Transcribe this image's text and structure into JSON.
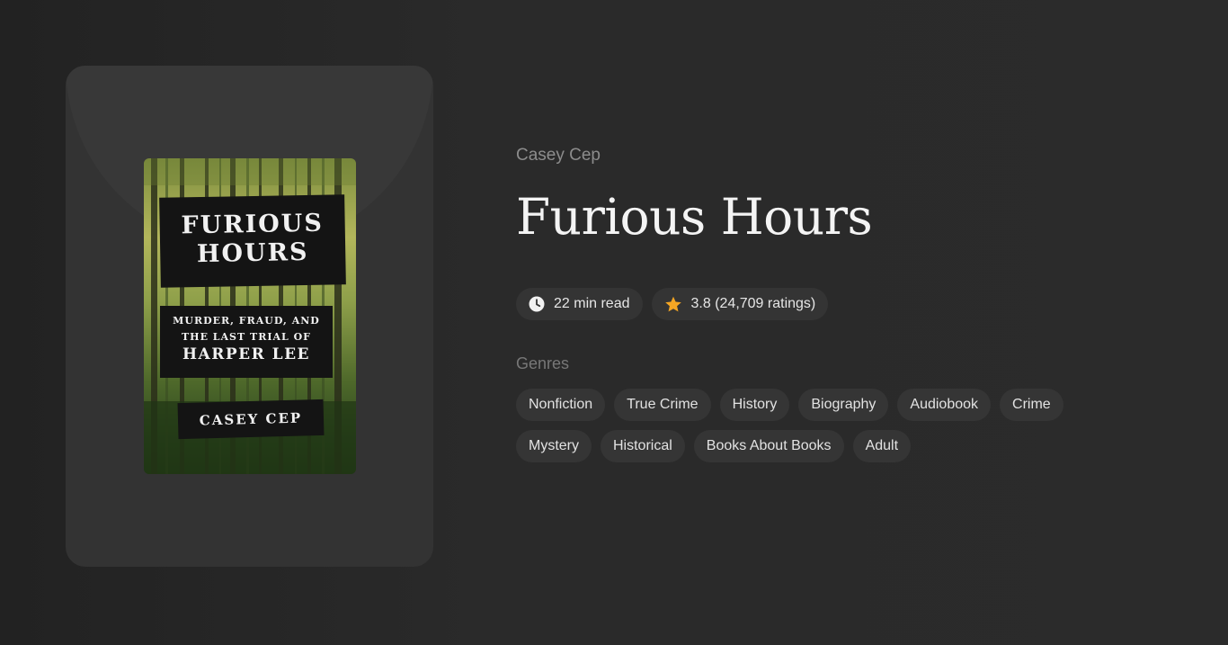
{
  "book": {
    "author": "Casey Cep",
    "title": "Furious Hours",
    "read_time": "22 min read",
    "rating_text": "3.8 (24,709 ratings)",
    "rating": 3.8,
    "ratings_count": "24,709"
  },
  "cover": {
    "title_line1": "FURIOUS",
    "title_line2": "HOURS",
    "subtitle_line1": "MURDER, FRAUD, AND",
    "subtitle_line2": "THE LAST TRIAL OF",
    "subtitle_line3": "HARPER LEE",
    "author": "CASEY CEP"
  },
  "genres_label": "Genres",
  "genres": [
    "Nonfiction",
    "True Crime",
    "History",
    "Biography",
    "Audiobook",
    "Crime",
    "Mystery",
    "Historical",
    "Books About Books",
    "Adult"
  ],
  "icons": {
    "read_time": "clock-icon",
    "rating": "star-icon"
  },
  "colors": {
    "star": "#f5a623",
    "background": "#2a2a2a",
    "panel": "#333333",
    "chip": "#353535"
  }
}
